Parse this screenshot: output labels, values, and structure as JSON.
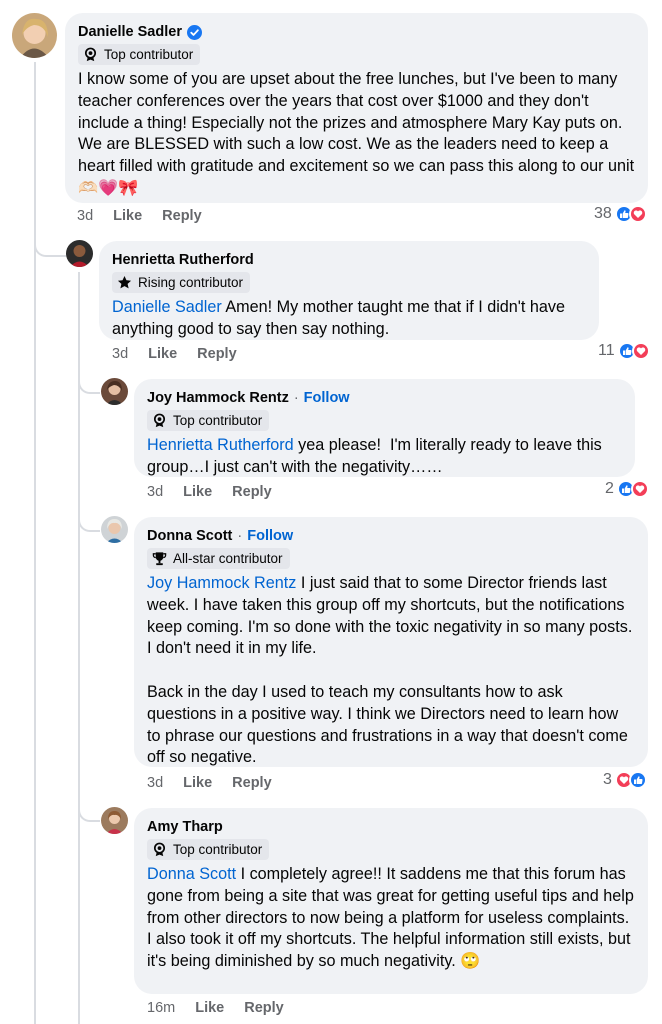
{
  "comments": [
    {
      "name": "Danielle Sadler",
      "badge": "Top contributor",
      "mention": "",
      "text": "I know some of you are upset about the free lunches, but I've been to many teacher conferences over the years that cost over $1000 and they don't include a thing! Especially not the prizes and atmosphere Mary Kay puts on. We are BLESSED with such a low cost. We as the leaders need to keep a heart filled with gratitude and excitement so we can pass this along to our unit 🫶🏻💗🎀",
      "time": "3d",
      "like_label": "Like",
      "reply_label": "Reply",
      "reactions": "38"
    },
    {
      "name": "Henrietta Rutherford",
      "badge": "Rising contributor",
      "mention": "Danielle Sadler",
      "text": " Amen! My mother taught me that if I didn't have anything good to say then say nothing.",
      "time": "3d",
      "like_label": "Like",
      "reply_label": "Reply",
      "reactions": "11"
    },
    {
      "name": "Joy Hammock Rentz",
      "follow": "Follow",
      "badge": "Top contributor",
      "mention": "Henrietta Rutherford",
      "text": " yea please!  I'm literally ready to leave this group…I just can't with the negativity……",
      "time": "3d",
      "like_label": "Like",
      "reply_label": "Reply",
      "reactions": "2"
    },
    {
      "name": "Donna Scott",
      "follow": "Follow",
      "badge": "All-star contributor",
      "mention": "Joy Hammock Rentz",
      "text": " I just said that to some Director friends last week. I have taken this group off my shortcuts, but the notifications keep coming. I'm so done with the toxic negativity in so many posts. I don't need it in my life.",
      "text2": "Back in the day I used to teach my consultants how to ask questions in a positive way. I think we Directors need to learn how to phrase our questions and frustrations in a way that doesn't come off so negative.",
      "time": "3d",
      "like_label": "Like",
      "reply_label": "Reply",
      "reactions": "3"
    },
    {
      "name": "Amy Tharp",
      "badge": "Top contributor",
      "mention": "Donna Scott",
      "text": " I completely agree!! It saddens me that this forum has gone from being a site that was great for getting useful tips and help from other directors to now being a platform for useless complaints. I also took it off my shortcuts. The helpful information still exists, but it's being diminished by so much negativity. 🙄",
      "time": "16m",
      "like_label": "Like",
      "reply_label": "Reply"
    }
  ],
  "colors": {
    "bubble": "#f0f2f5",
    "link": "#0064d1",
    "meta": "#65676b",
    "like_reaction": "#1877f2",
    "love_reaction": "#f33e58"
  }
}
